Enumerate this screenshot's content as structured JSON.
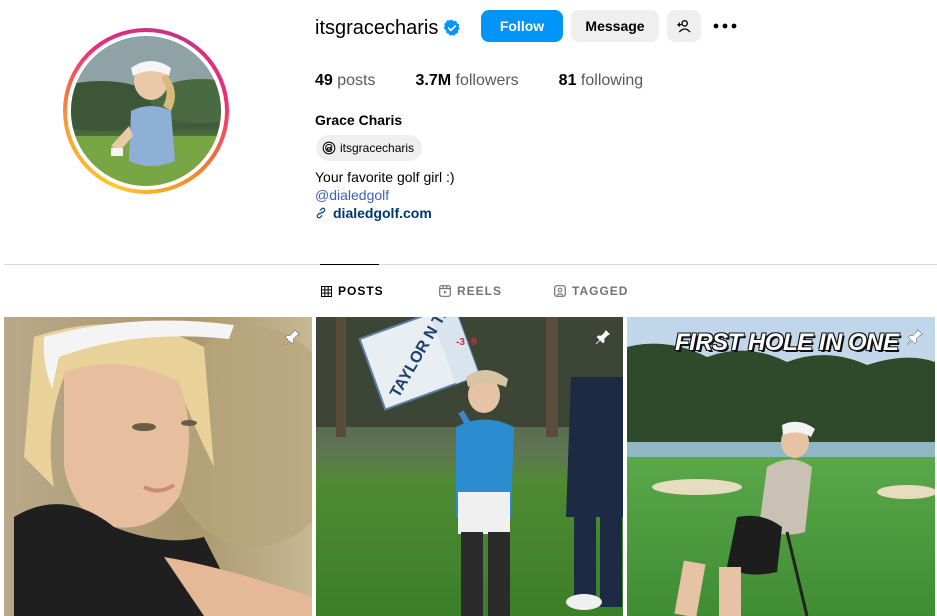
{
  "profile": {
    "username": "itsgracecharis",
    "full_name": "Grace Charis",
    "threads_handle": "itsgracecharis",
    "bio": "Your favorite golf girl :)",
    "mention": "@dialedgolf",
    "website": "dialedgolf.com"
  },
  "actions": {
    "follow_label": "Follow",
    "message_label": "Message"
  },
  "stats": {
    "posts_count": "49",
    "posts_label": "posts",
    "followers_count": "3.7M",
    "followers_label": "followers",
    "following_count": "81",
    "following_label": "following"
  },
  "tabs": [
    {
      "label": "POSTS",
      "icon": "grid-icon",
      "active": true
    },
    {
      "label": "REELS",
      "icon": "reels-icon",
      "active": false
    },
    {
      "label": "TAGGED",
      "icon": "tagged-icon",
      "active": false
    }
  ],
  "posts": [
    {
      "pinned": true,
      "overlay_text": ""
    },
    {
      "pinned": true,
      "overlay_text": "",
      "sign_text": "TAYLOR N TARDE HODGES",
      "sign_numbers": "-3 -9"
    },
    {
      "pinned": true,
      "overlay_text": "FIRST HOLE IN ONE"
    }
  ],
  "colors": {
    "follow_button": "#0095f6",
    "verified_badge": "#0095f6",
    "link": "#00376b",
    "mention": "#3f5fbf"
  }
}
